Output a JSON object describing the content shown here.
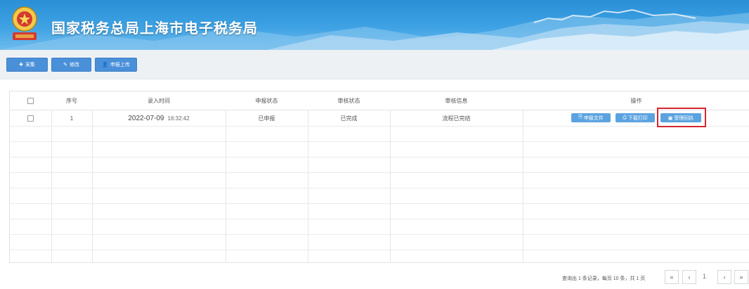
{
  "header": {
    "title": "国家税务总局上海市电子税务局",
    "emblem_icon": "tax-emblem-icon"
  },
  "toolbar": {
    "buttons": [
      {
        "icon": "plus-icon",
        "label": "采集"
      },
      {
        "icon": "edit-icon",
        "label": "修改"
      },
      {
        "icon": "user-upload-icon",
        "label": "申报上传"
      }
    ]
  },
  "table": {
    "columns": [
      "",
      "序号",
      "录入时间",
      "申报状态",
      "审核状态",
      "审核信息",
      "操作"
    ],
    "rows": [
      {
        "index": "1",
        "date": "2022-07-09",
        "time": "16:32:42",
        "declare_status": "已申报",
        "review_status": "已完成",
        "review_info": "流程已完结",
        "actions": [
          {
            "icon": "document-icon",
            "label": "申报文件"
          },
          {
            "icon": "print-icon",
            "label": "下载打印"
          },
          {
            "icon": "receipt-icon",
            "label": "受理回执"
          }
        ]
      }
    ]
  },
  "pagination": {
    "info": "查询出 1 条记录，每页 10 条，共 1 页",
    "current_page": "1",
    "first": "«",
    "prev": "‹",
    "next": "›",
    "last": "»"
  },
  "colors": {
    "banner": "#3ea2e4",
    "button": "#4a90d9",
    "highlight": "#d7262d"
  }
}
